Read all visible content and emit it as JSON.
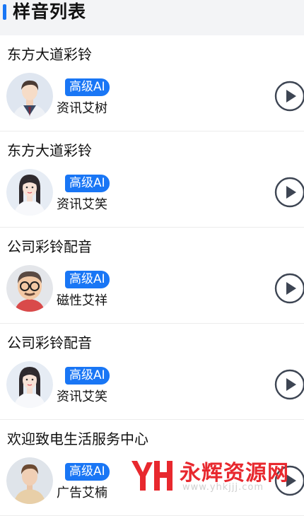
{
  "header": {
    "title": "样音列表"
  },
  "badge_label": "高级AI",
  "items": [
    {
      "title": "东方大道彩铃",
      "speaker": "资讯艾树",
      "avatar": "male-avatar-suit"
    },
    {
      "title": "东方大道彩铃",
      "speaker": "资讯艾笑",
      "avatar": "female-avatar"
    },
    {
      "title": "公司彩铃配音",
      "speaker": "磁性艾祥",
      "avatar": "male-avatar-glasses"
    },
    {
      "title": "公司彩铃配音",
      "speaker": "资讯艾笑",
      "avatar": "female-avatar"
    },
    {
      "title": "欢迎致电生活服务中心",
      "speaker": "广告艾楠",
      "avatar": "male-avatar-casual"
    }
  ],
  "watermark": {
    "brand": "永辉资源网",
    "url": "www.yhkjjj.com"
  },
  "colors": {
    "accent": "#1976f5",
    "header_bg": "#f3f4f6",
    "watermark_red": "#e8282e"
  }
}
